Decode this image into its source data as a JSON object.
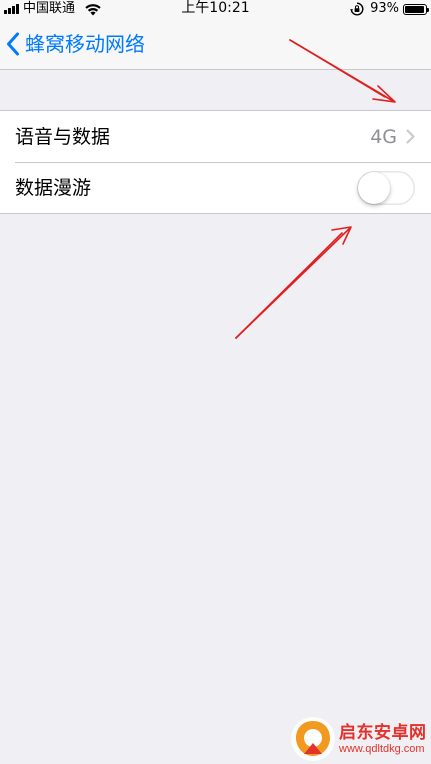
{
  "status_bar": {
    "carrier": "中国联通",
    "time": "上午10:21",
    "battery_percent": "93%",
    "battery_level": 0.93,
    "icons": [
      "signal-bars-icon",
      "wifi-icon",
      "rotation-lock-icon",
      "battery-icon"
    ]
  },
  "nav": {
    "back_label": "蜂窝移动网络",
    "back_icon": "chevron-left-icon",
    "accent_color": "#007aff"
  },
  "settings": {
    "cells": [
      {
        "title": "语音与数据",
        "value": "4G",
        "accessory": "chevron-right-icon"
      },
      {
        "title": "数据漫游",
        "toggle_on": false
      }
    ]
  },
  "annotations": {
    "arrow_color": "#e02020",
    "count": 2
  },
  "watermark": {
    "title": "启东安卓网",
    "url": "www.qdltdkg.com",
    "color": "#e3322c"
  }
}
